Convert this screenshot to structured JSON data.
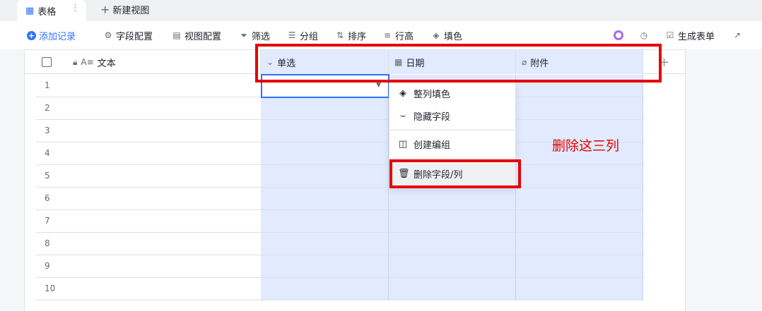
{
  "tabs": {
    "active_label": "表格",
    "more_glyph": "⋮",
    "new_view_label": "新建视图"
  },
  "toolbar": {
    "add_record": "添加记录",
    "field_config": "字段配置",
    "view_config": "视图配置",
    "filter": "筛选",
    "group": "分组",
    "sort": "排序",
    "row_height": "行高",
    "fill_color": "填色",
    "generate_form": "生成表单"
  },
  "columns": [
    {
      "label": "文本",
      "icon": "text-icon"
    },
    {
      "label": "单选",
      "icon": "single-select-icon"
    },
    {
      "label": "日期",
      "icon": "date-icon"
    },
    {
      "label": "附件",
      "icon": "attachment-icon"
    }
  ],
  "rows": [
    "1",
    "2",
    "3",
    "4",
    "5",
    "6",
    "7",
    "8",
    "9",
    "10"
  ],
  "context_menu": {
    "fill_column": "整列填色",
    "hide_field": "隐藏字段",
    "create_group": "创建编组",
    "delete_field": "删除字段/列"
  },
  "annotation": "删除这三列",
  "colors": {
    "accent": "#3370ff",
    "selected_column": "#e1eaff",
    "annotation_red": "#e60000"
  }
}
